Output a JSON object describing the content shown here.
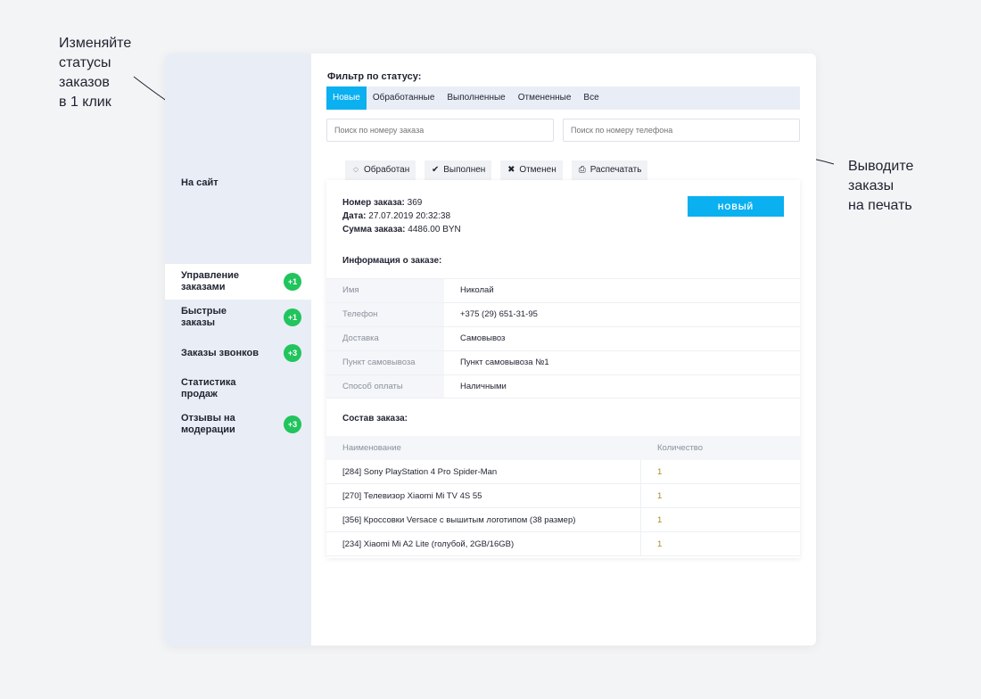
{
  "callouts": {
    "left": [
      "Изменяйте",
      "статусы",
      "заказов",
      "в 1 клик"
    ],
    "right": [
      "Выводите",
      "заказы",
      "на печать"
    ]
  },
  "sidebar": {
    "site_link": "На сайт",
    "items": [
      {
        "label": "Управление заказами",
        "badge": "+1",
        "active": true
      },
      {
        "label": "Быстрые заказы",
        "badge": "+1"
      },
      {
        "label": "Заказы звонков",
        "badge": "+3"
      },
      {
        "label": "Статистика продаж",
        "badge": ""
      },
      {
        "label": "Отзывы на модерации",
        "badge": "+3"
      }
    ]
  },
  "filter": {
    "label": "Фильтр по статусу:",
    "tabs": [
      "Новые",
      "Обработанные",
      "Выполненные",
      "Отмененные",
      "Все"
    ],
    "search_order_placeholder": "Поиск по номеру заказа",
    "search_phone_placeholder": "Поиск по номеру телефона"
  },
  "actions": {
    "processed": "Обработан",
    "done": "Выполнен",
    "cancelled": "Отменен",
    "print": "Распечатать"
  },
  "order": {
    "number_label": "Номер заказа:",
    "number": "369",
    "date_label": "Дата:",
    "date": "27.07.2019 20:32:38",
    "sum_label": "Сумма заказа:",
    "sum": "4486.00 BYN",
    "status": "НОВЫЙ",
    "info_title": "Информация о заказе:",
    "info": [
      {
        "k": "Имя",
        "v": "Николай"
      },
      {
        "k": "Телефон",
        "v": "+375 (29) 651-31-95"
      },
      {
        "k": "Доставка",
        "v": "Самовывоз"
      },
      {
        "k": "Пункт самовывоза",
        "v": "Пункт самовывоза №1"
      },
      {
        "k": "Способ оплаты",
        "v": "Наличными"
      }
    ],
    "items_title": "Состав заказа:",
    "items_head": {
      "name": "Наименование",
      "qty": "Количество"
    },
    "items": [
      {
        "name": "[284] Sony PlayStation 4 Pro Spider-Man",
        "qty": "1"
      },
      {
        "name": "[270] Телевизор Xiaomi Mi TV 4S 55",
        "qty": "1"
      },
      {
        "name": "[356] Кроссовки Versace с вышитым логотипом (38 размер)",
        "qty": "1"
      },
      {
        "name": "[234] Xiaomi Mi A2 Lite (голубой, 2GB/16GB)",
        "qty": "1"
      }
    ]
  }
}
